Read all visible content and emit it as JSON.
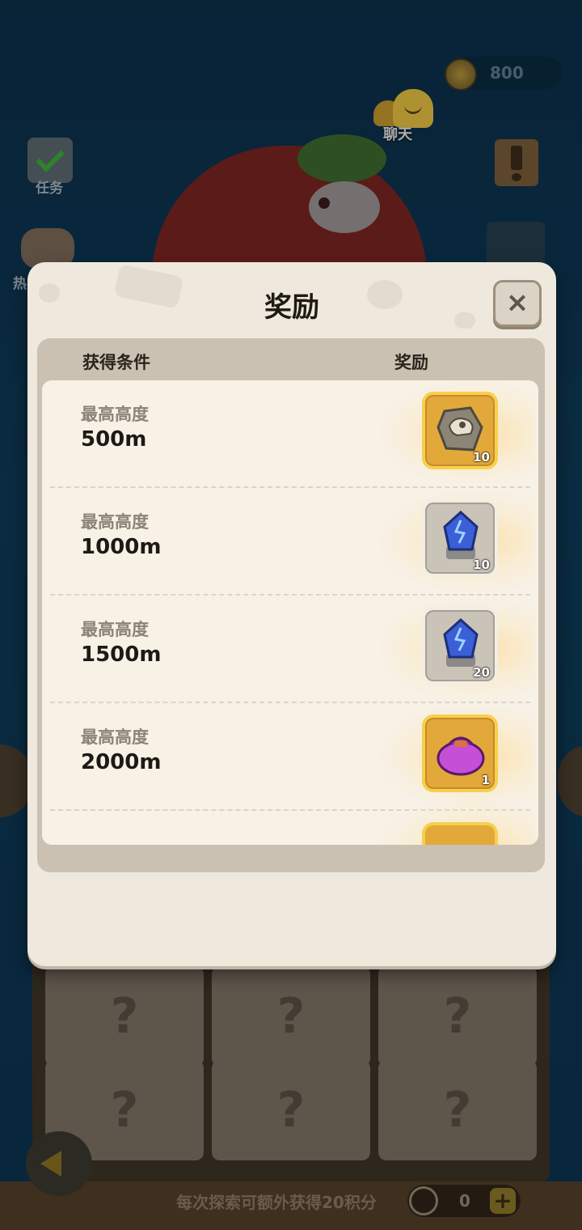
{
  "hud": {
    "currency_value": "800",
    "chat_label": "聊天",
    "task_label": "任务",
    "hot_label": "热"
  },
  "modal": {
    "title": "奖励",
    "close_glyph": "×",
    "header": {
      "condition": "获得条件",
      "reward": "奖励"
    },
    "rows": [
      {
        "label": "最高高度",
        "value": "500m",
        "reward_icon": "fossil-skull-icon",
        "reward_count": "10",
        "frame": "gold"
      },
      {
        "label": "最高高度",
        "value": "1000m",
        "reward_icon": "blue-crystal-icon",
        "reward_count": "10",
        "frame": "silver"
      },
      {
        "label": "最高高度",
        "value": "1500m",
        "reward_icon": "blue-crystal-icon",
        "reward_count": "20",
        "frame": "silver"
      },
      {
        "label": "最高高度",
        "value": "2000m",
        "reward_icon": "purple-loot-bag-icon",
        "reward_count": "1",
        "frame": "gold"
      }
    ]
  },
  "grid": {
    "cell_glyph": "?"
  },
  "footer": {
    "text": "每次探索可额外获得20积分",
    "points_value": "0",
    "plus_glyph": "+"
  },
  "colors": {
    "background": "#0d3550",
    "modal": "#efe8dc",
    "gold_frame": "#e2a93a",
    "silver_frame": "#c9c3b8"
  }
}
